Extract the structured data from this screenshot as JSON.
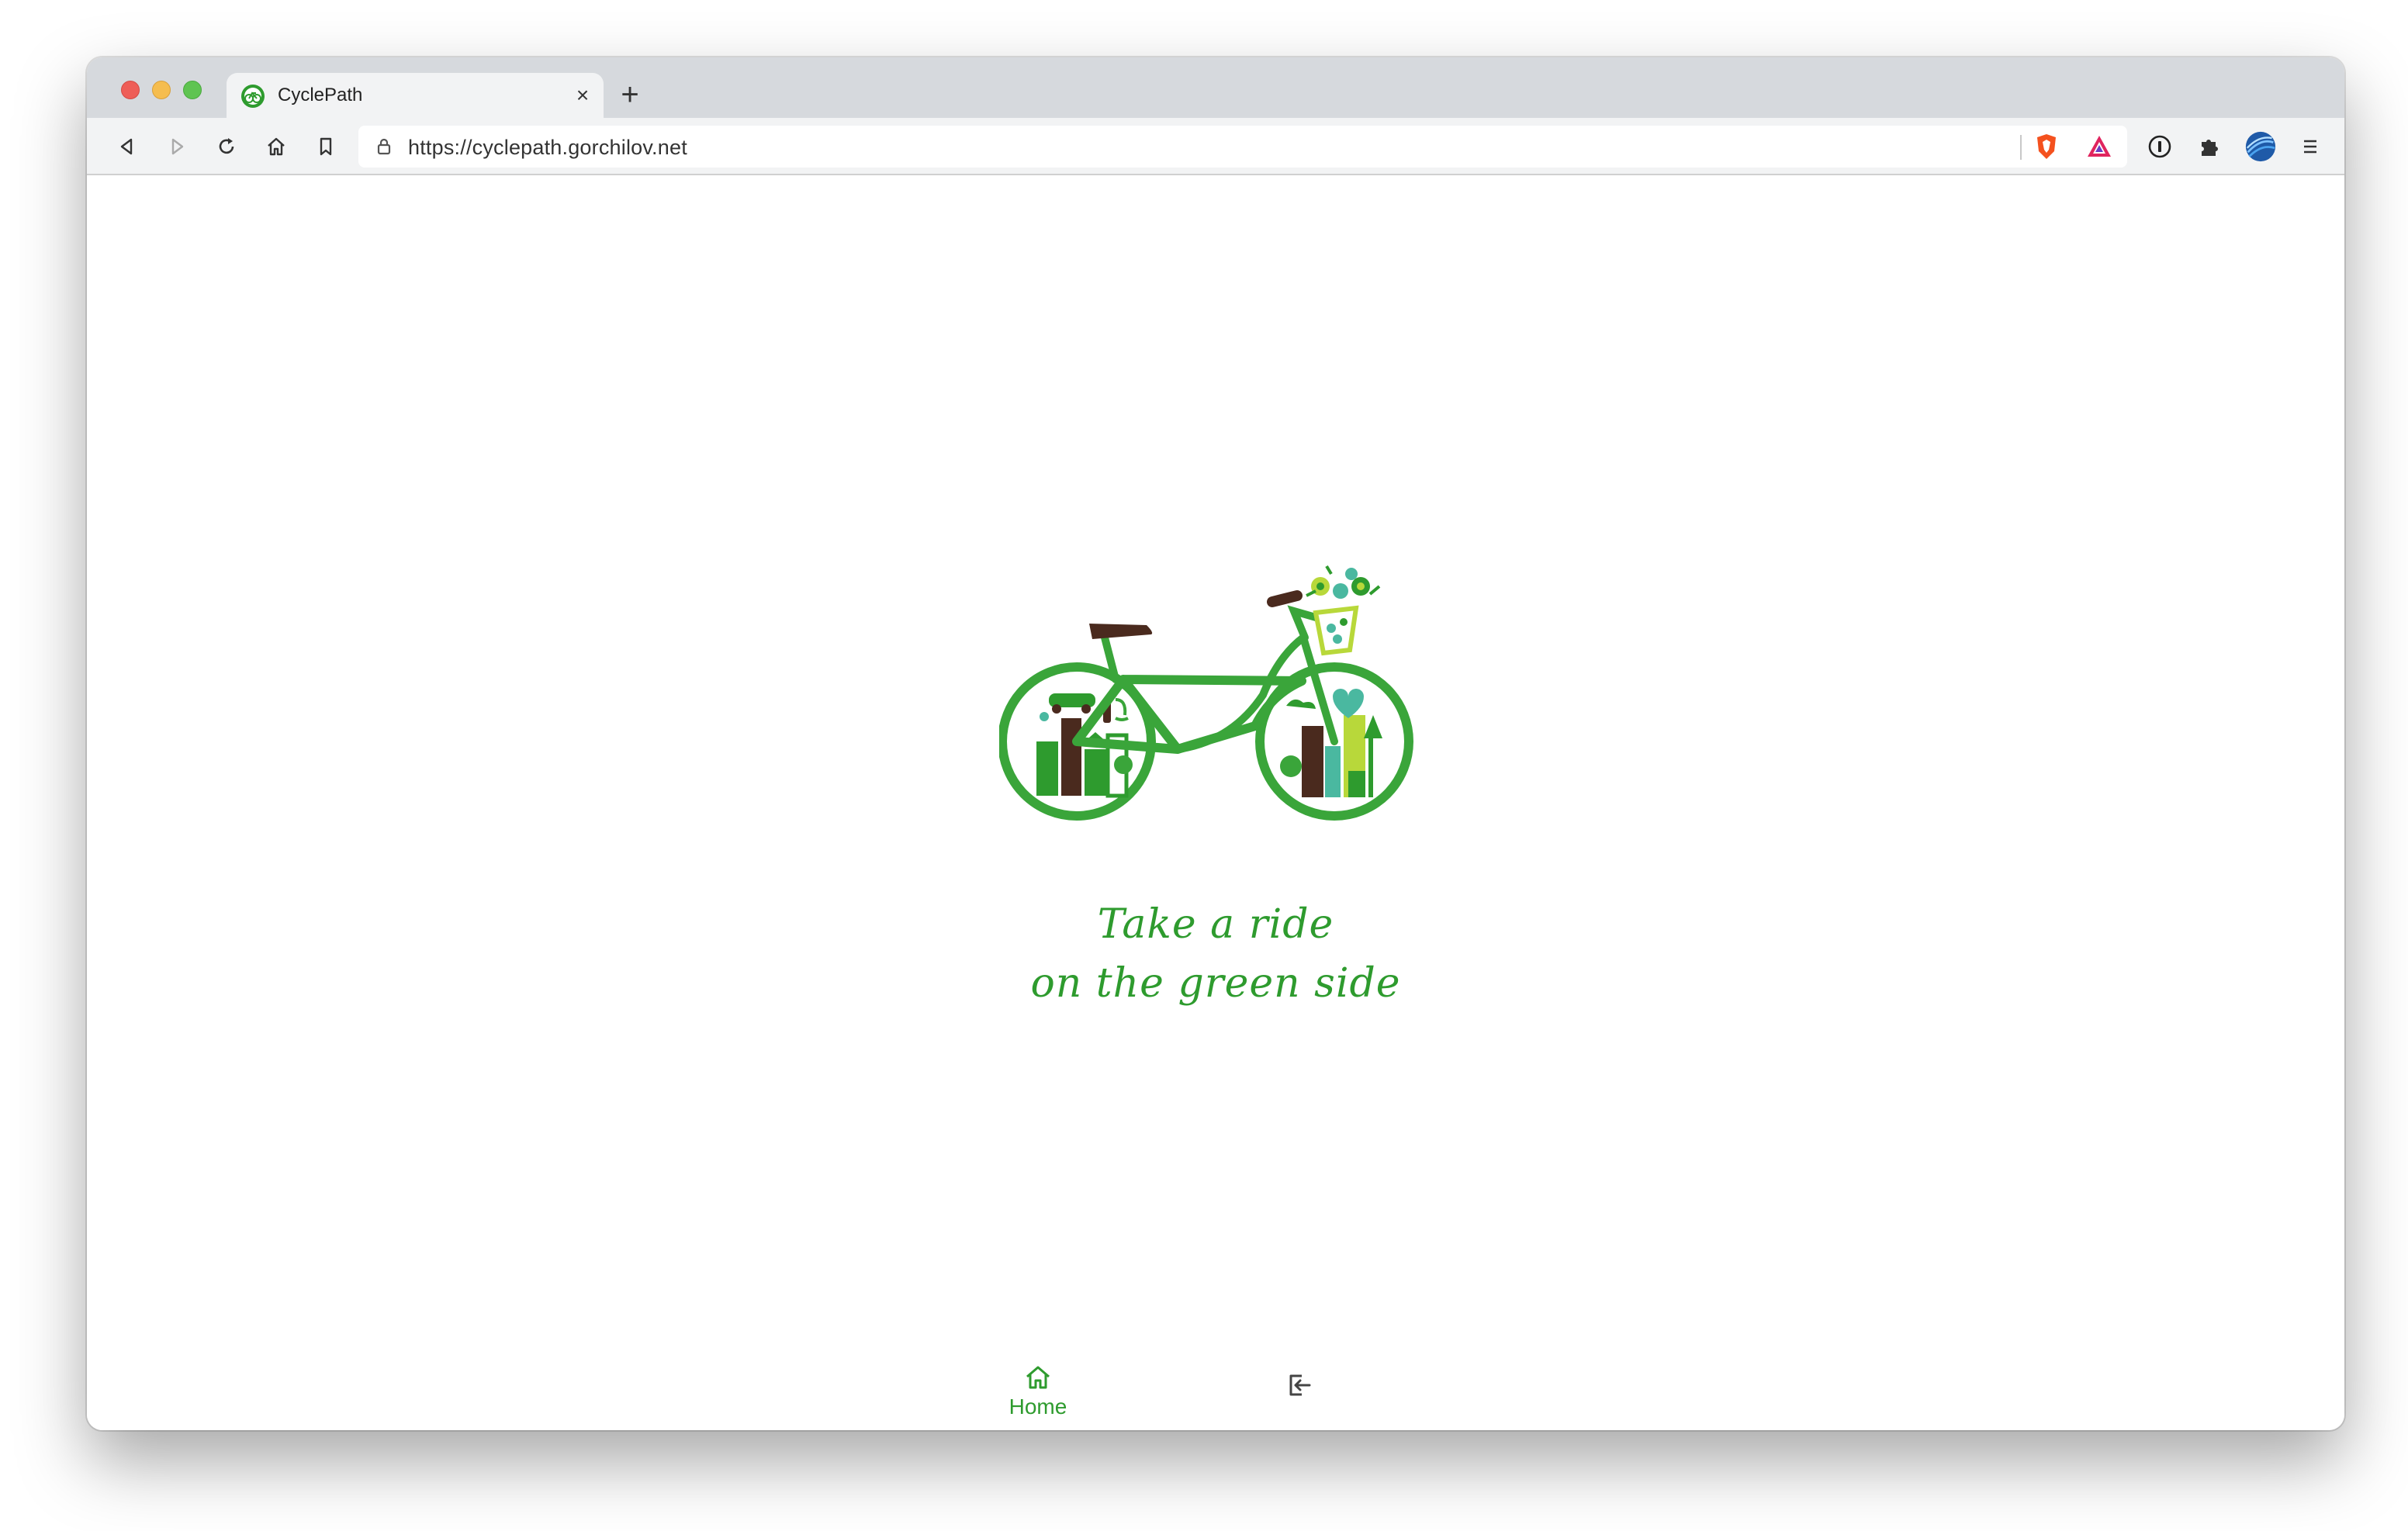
{
  "browser": {
    "tab": {
      "title": "CyclePath",
      "close_glyph": "×",
      "favicon": "cyclepath-logo-icon"
    },
    "new_tab_glyph": "+",
    "url": "https://cyclepath.gorchilov.net",
    "toolbar_icons": [
      "back-icon",
      "forward-icon",
      "reload-icon",
      "home-icon",
      "bookmark-icon",
      "lock-icon",
      "brave-shields-icon",
      "brave-rewards-icon",
      "password-manager-icon",
      "extensions-icon",
      "profile-avatar-icon",
      "menu-icon"
    ]
  },
  "page": {
    "tagline_line1": "Take a ride",
    "tagline_line2": "on the green side",
    "accent_color": "#2e9b2e"
  },
  "bottom_nav": {
    "items": [
      {
        "label": "Home",
        "icon": "home-icon",
        "active": true
      },
      {
        "label": "",
        "icon": "login-icon",
        "active": false
      }
    ]
  }
}
